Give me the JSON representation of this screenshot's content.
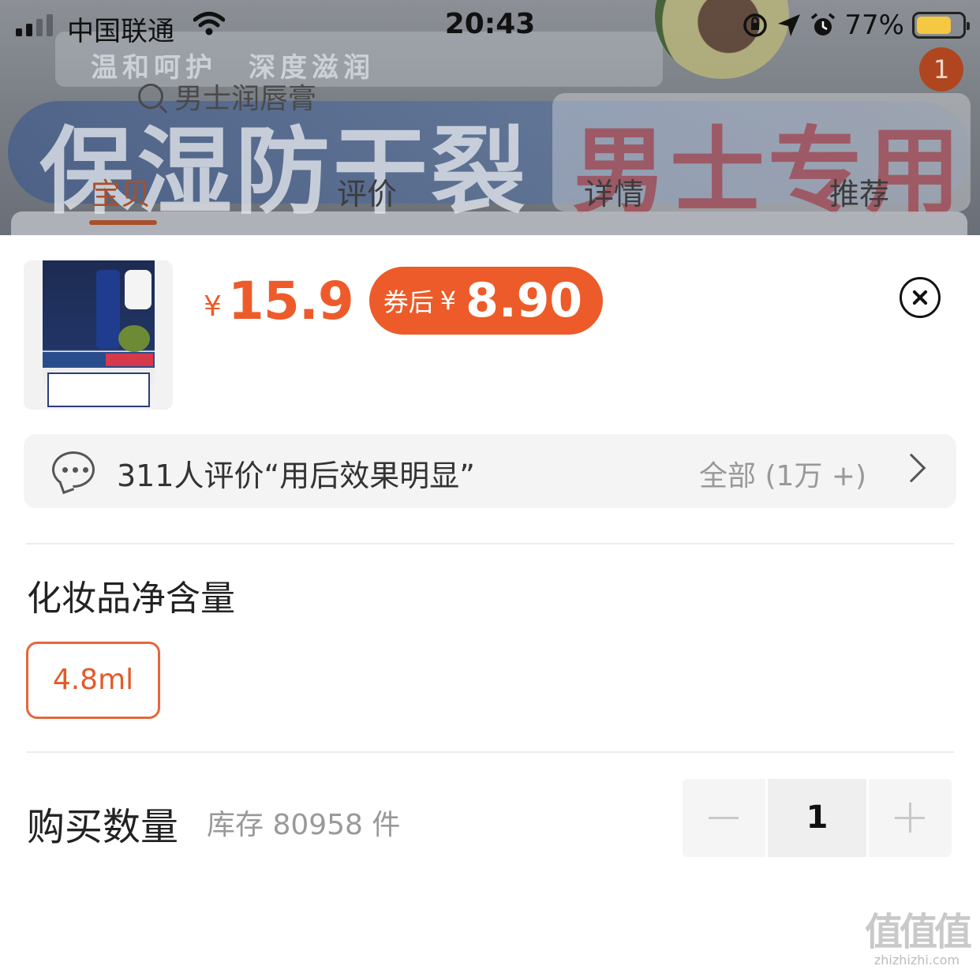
{
  "status_bar": {
    "carrier": "中国联通",
    "time": "20:43",
    "battery_text": "77%",
    "battery_level": 0.77
  },
  "background_page": {
    "slogan": "温和呵护　深度滋润",
    "search_text": "男士润唇膏",
    "banner_left": "保湿防干裂",
    "banner_right": "男士专用",
    "cart_badge": "1",
    "tabs": [
      "宝贝",
      "评价",
      "详情",
      "推荐"
    ],
    "active_tab": 0
  },
  "sheet": {
    "price_symbol": "¥",
    "price": "15.9",
    "coupon_label": "券后",
    "coupon_symbol": "¥",
    "coupon_price": "8.90",
    "review_summary": "311人评价“用后效果明显”",
    "review_all": "全部 (1万 +)",
    "spec_title": "化妆品净含量",
    "spec_options": [
      "4.8ml"
    ],
    "spec_selected": "4.8ml",
    "quantity_title": "购买数量",
    "stock_text": "库存 80958 件",
    "quantity": "1"
  },
  "watermark": {
    "logo": "值值值",
    "url": "zhizhizhi.com"
  },
  "colors": {
    "accent": "#ee5b2a",
    "coupon_bg": "#ec5b29",
    "battery": "#f6c740"
  }
}
